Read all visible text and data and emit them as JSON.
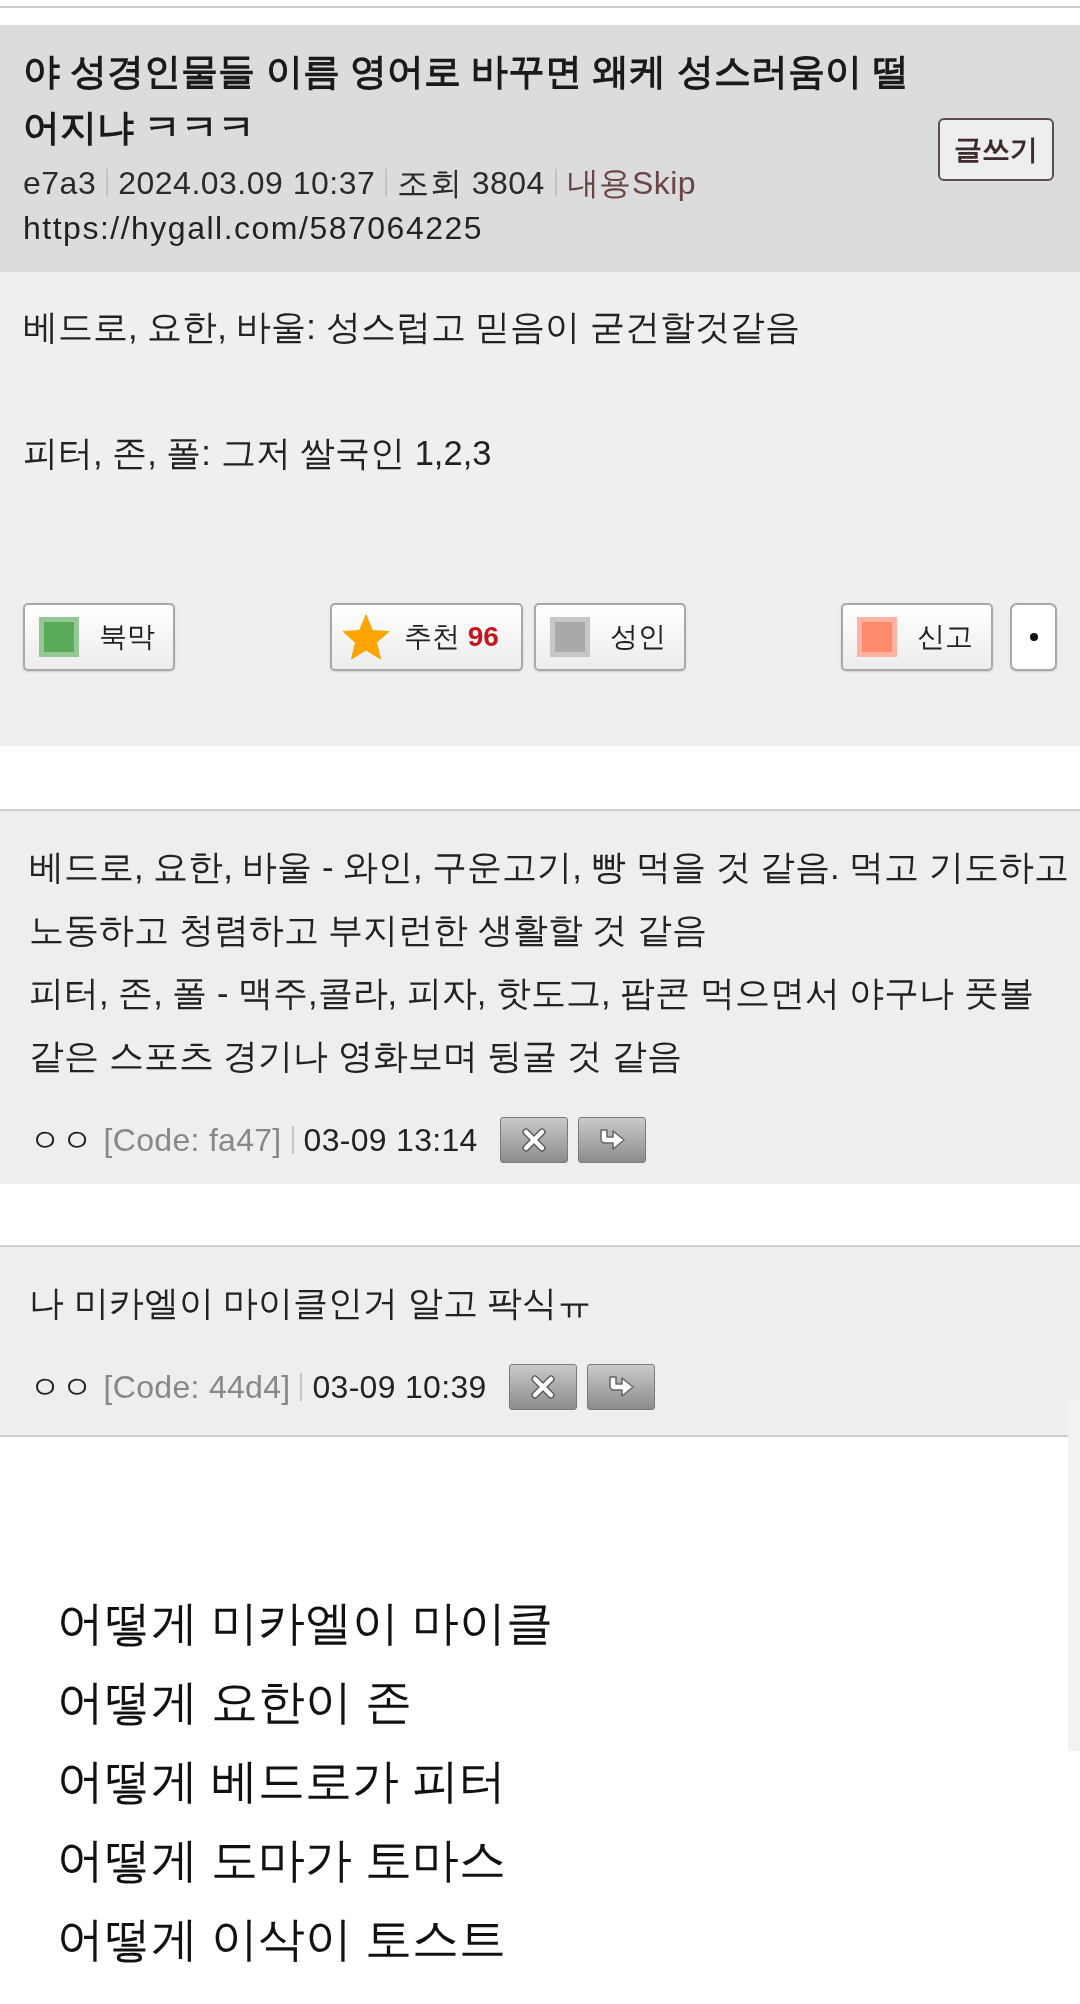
{
  "post": {
    "title": "야 성경인물들 이름 영어로 바꾸면 왜케 성스러움이 떨어지냐 ㅋㅋㅋ",
    "write_button": "글쓰기",
    "meta": [
      {
        "kind": "author",
        "text": "e7a3"
      },
      {
        "kind": "date",
        "text": "2024.03.09 10:37"
      },
      {
        "kind": "views",
        "text": "조회 3804"
      },
      {
        "kind": "link",
        "text": "내용Skip"
      }
    ],
    "url": "https://hygall.com/587064225"
  },
  "body": {
    "paragraphs": [
      "베드로, 요한, 바울: 성스럽고 믿음이 굳건할것같음",
      "피터, 존, 폴: 그저 쌀국인 1,2,3"
    ]
  },
  "actions": {
    "left": [
      {
        "kind": "square",
        "label": "북막",
        "color": "#5aaa5a"
      }
    ],
    "center": [
      {
        "kind": "star",
        "label": "추천",
        "count": "96"
      },
      {
        "kind": "square",
        "label": "성인",
        "color": "#a9a9a9"
      }
    ],
    "right": [
      {
        "kind": "square",
        "label": "신고",
        "color": "#ff8a6e"
      },
      {
        "kind": "dot"
      }
    ]
  },
  "comments": [
    {
      "nickname": "ㅇㅇ",
      "code": "[Code: fa47]",
      "time": "03-09 13:14",
      "paragraphs": [
        "베드로, 요한, 바울 - 와인, 구운고기, 빵 먹을 것 같음. 먹고 기도하고 노동하고 청렴하고 부지런한 생활할 것 같음",
        "피터, 존, 폴 - 맥주,콜라, 피자, 핫도그, 팝콘 먹으면서 야구나 풋볼 같은 스포츠 경기나 영화보며 뒹굴 것 같음"
      ]
    },
    {
      "nickname": "ㅇㅇ",
      "code": "[Code: 44d4]",
      "time": "03-09 10:39",
      "paragraphs": [
        "나 미카엘이 마이클인거 알고 팍식ㅠ"
      ]
    }
  ],
  "footer_lines": [
    "어떻게 미카엘이 마이클",
    "어떻게 요한이 존",
    "어떻게 베드로가 피터",
    "어떻게 도마가 토마스",
    "어떻게 이삭이 토스트"
  ]
}
